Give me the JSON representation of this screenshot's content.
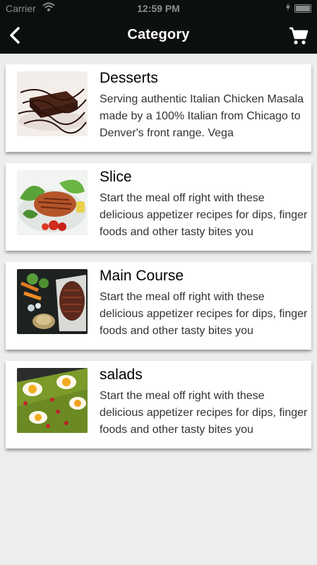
{
  "status_bar": {
    "carrier": "Carrier",
    "time": "12:59 PM"
  },
  "nav": {
    "title": "Category",
    "back_icon": "chevron-left-icon",
    "cart_icon": "cart-icon"
  },
  "categories": [
    {
      "title": "Desserts",
      "description": "Serving authentic Italian Chicken Masala made by a 100% Italian from Chicago to Denver's front range. Vega"
    },
    {
      "title": "Slice",
      "description": "Start the meal off right with these delicious appetizer recipes for dips, finger foods and other tasty bites you"
    },
    {
      "title": "Main Course",
      "description": "Start the meal off right with these delicious appetizer recipes for dips, finger foods and other tasty bites you"
    },
    {
      "title": "salads",
      "description": "Start the meal off right with these delicious appetizer recipes for dips, finger foods and other tasty bites you"
    }
  ]
}
